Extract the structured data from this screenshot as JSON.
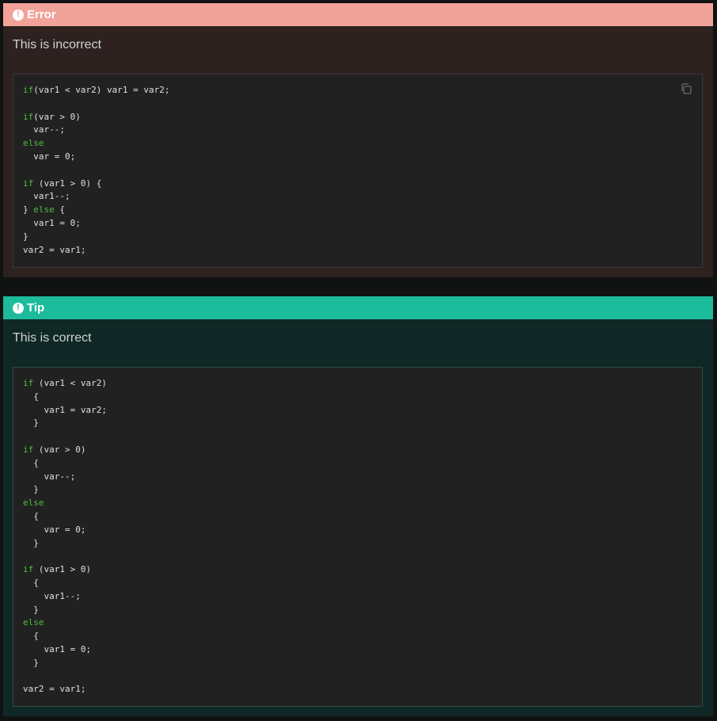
{
  "admonitions": [
    {
      "type": "error",
      "title": "Error",
      "icon": "exclamation-circle-icon",
      "body": "This is incorrect",
      "header_color": "#f1a39a",
      "code": [
        [
          [
            "kw",
            "if"
          ],
          [
            "t",
            "(var1 < var2) var1 = var2;"
          ]
        ],
        [],
        [
          [
            "kw",
            "if"
          ],
          [
            "t",
            "(var > 0)"
          ]
        ],
        [
          [
            "t",
            "  var--;"
          ]
        ],
        [
          [
            "kw",
            "else"
          ]
        ],
        [
          [
            "t",
            "  var = 0;"
          ]
        ],
        [],
        [
          [
            "kw",
            "if"
          ],
          [
            "t",
            " (var1 > 0) {"
          ]
        ],
        [
          [
            "t",
            "  var1--;"
          ]
        ],
        [
          [
            "t",
            "} "
          ],
          [
            "kw",
            "else"
          ],
          [
            "t",
            " {"
          ]
        ],
        [
          [
            "t",
            "  var1 = 0;"
          ]
        ],
        [
          [
            "t",
            "}"
          ]
        ],
        [
          [
            "t",
            "var2 = var1;"
          ]
        ]
      ],
      "copy_icon": "copy-icon"
    },
    {
      "type": "tip",
      "title": "Tip",
      "icon": "exclamation-circle-icon",
      "body": "This is correct",
      "header_color": "#1bbb9b",
      "code": [
        [
          [
            "kw",
            "if"
          ],
          [
            "t",
            " (var1 < var2)"
          ]
        ],
        [
          [
            "t",
            "  {"
          ]
        ],
        [
          [
            "t",
            "    var1 = var2;"
          ]
        ],
        [
          [
            "t",
            "  }"
          ]
        ],
        [],
        [
          [
            "kw",
            "if"
          ],
          [
            "t",
            " (var > 0)"
          ]
        ],
        [
          [
            "t",
            "  {"
          ]
        ],
        [
          [
            "t",
            "    var--;"
          ]
        ],
        [
          [
            "t",
            "  }"
          ]
        ],
        [
          [
            "kw",
            "else"
          ]
        ],
        [
          [
            "t",
            "  {"
          ]
        ],
        [
          [
            "t",
            "    var = 0;"
          ]
        ],
        [
          [
            "t",
            "  }"
          ]
        ],
        [],
        [
          [
            "kw",
            "if"
          ],
          [
            "t",
            " (var1 > 0)"
          ]
        ],
        [
          [
            "t",
            "  {"
          ]
        ],
        [
          [
            "t",
            "    var1--;"
          ]
        ],
        [
          [
            "t",
            "  }"
          ]
        ],
        [
          [
            "kw",
            "else"
          ]
        ],
        [
          [
            "t",
            "  {"
          ]
        ],
        [
          [
            "t",
            "    var1 = 0;"
          ]
        ],
        [
          [
            "t",
            "  }"
          ]
        ],
        [],
        [
          [
            "t",
            "var2 = var1;"
          ]
        ]
      ]
    }
  ]
}
